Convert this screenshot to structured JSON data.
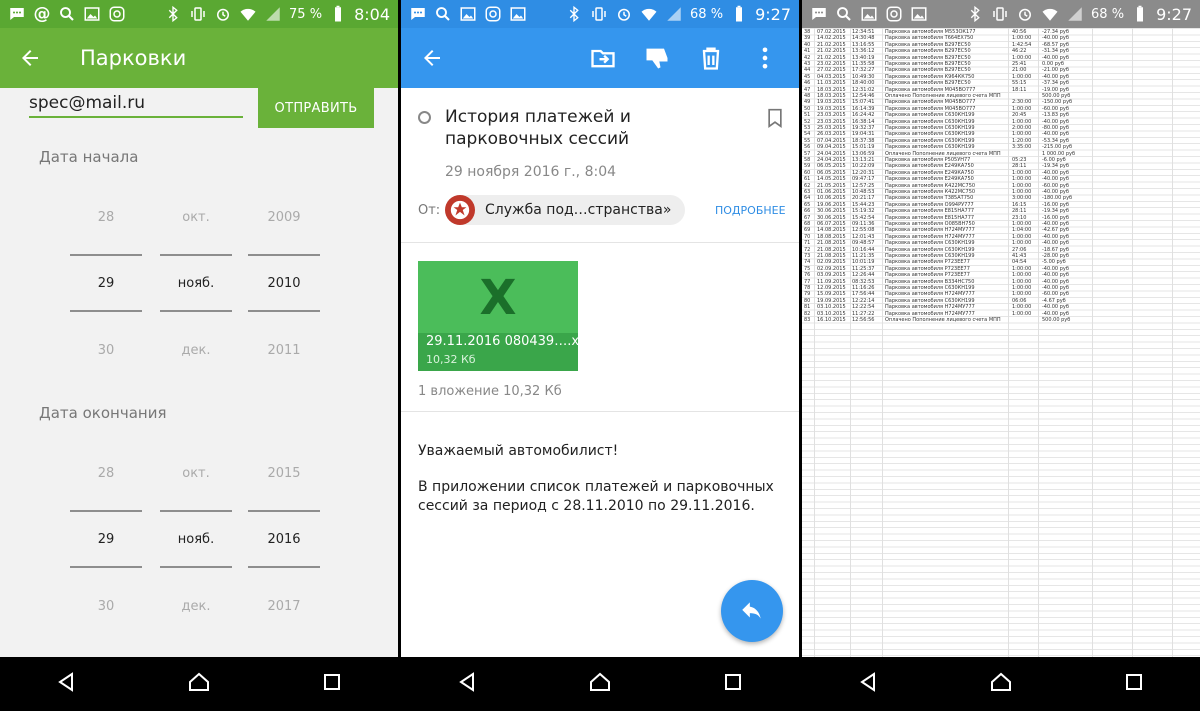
{
  "status_left": {
    "time": "8:04",
    "battery": "75 %"
  },
  "status_middle": {
    "time": "9:27",
    "battery": "68 %"
  },
  "status_right": {
    "time": "9:27",
    "battery": "68 %"
  },
  "colors": {
    "green": "#6ab23a",
    "blue": "#3596ee",
    "excel_green": "#4bbd5a"
  },
  "parking": {
    "title": "Парковки",
    "email_value": "spec@mail.ru",
    "send_label": "ОТПРАВИТЬ",
    "start_label": "Дата начала",
    "end_label": "Дата окончания",
    "start_picker": {
      "day": [
        "28",
        "29",
        "30"
      ],
      "month": [
        "окт.",
        "нояб.",
        "дек."
      ],
      "year": [
        "2009",
        "2010",
        "2011"
      ]
    },
    "end_picker": {
      "day": [
        "28",
        "29",
        "30"
      ],
      "month": [
        "окт.",
        "нояб.",
        "дек."
      ],
      "year": [
        "2015",
        "2016",
        "2017"
      ]
    }
  },
  "mail": {
    "subject": "История платежей и парковочных сессий",
    "date": "29 ноября 2016 г., 8:04",
    "from_label": "От:",
    "from_name": "Служба под…странства»",
    "more_label": "ПОДРОБНЕЕ",
    "attachment": {
      "icon_letter": "X",
      "file_name": "29.11.2016 080439….xlsx",
      "file_size": "10,32 Кб"
    },
    "attach_count": "1 вложение 10,32 Кб",
    "greeting": "Уважаемый автомобилист!",
    "body": "В приложении список платежей и парковочных сессий за период с 28.11.2010 по 29.11.2016."
  },
  "sheet": {
    "rows": [
      {
        "n": "38",
        "d": "07.02.2015",
        "t": "12:34:51",
        "desc": "Парковка автомобиля М553ОК177",
        "q": "40:56",
        "s": "-27.34 руб"
      },
      {
        "n": "39",
        "d": "14.02.2015",
        "t": "14:30:48",
        "desc": "Парковка автомобиля Т664ЕХ750",
        "q": "1:00:00",
        "s": "-40.00 руб"
      },
      {
        "n": "40",
        "d": "21.02.2015",
        "t": "13:16:55",
        "desc": "Парковка автомобиля В297ЕС50",
        "q": "1:42:54",
        "s": "-68.57 руб"
      },
      {
        "n": "41",
        "d": "21.02.2015",
        "t": "13:36:12",
        "desc": "Парковка автомобиля В297ЕС50",
        "q": "46:22",
        "s": "-31.34 руб"
      },
      {
        "n": "42",
        "d": "21.02.2015",
        "t": "13:40:19",
        "desc": "Парковка автомобиля В297ЕС50",
        "q": "1:00:00",
        "s": "-40.00 руб"
      },
      {
        "n": "43",
        "d": "23.02.2015",
        "t": "11:35:58",
        "desc": "Парковка автомобиля В297ЕС50",
        "q": "25:41",
        "s": "0.00 руб"
      },
      {
        "n": "44",
        "d": "27.02.2015",
        "t": "17:32:27",
        "desc": "Парковка автомобиля В297ЕС50",
        "q": "21:00",
        "s": "-21.00 руб"
      },
      {
        "n": "45",
        "d": "04.03.2015",
        "t": "10:49:30",
        "desc": "Парковка автомобиля К964КК750",
        "q": "1:00:00",
        "s": "-40.00 руб"
      },
      {
        "n": "46",
        "d": "11.03.2015",
        "t": "18:40:00",
        "desc": "Парковка автомобиля В297ЕС50",
        "q": "55:15",
        "s": "-37.34 руб"
      },
      {
        "n": "47",
        "d": "18.03.2015",
        "t": "12:31:02",
        "desc": "Парковка автомобиля М045ВО777",
        "q": "18:11",
        "s": "-19.00 руб"
      },
      {
        "n": "48",
        "d": "18.03.2015",
        "t": "12:54:46",
        "desc": "Оплачено Пополнение лицевого счета МПП",
        "q": "",
        "s": "500.00 руб"
      },
      {
        "n": "49",
        "d": "19.03.2015",
        "t": "15:07:41",
        "desc": "Парковка автомобиля М045ВО777",
        "q": "2:30:00",
        "s": "-150.00 руб"
      },
      {
        "n": "50",
        "d": "19.03.2015",
        "t": "16:14:39",
        "desc": "Парковка автомобиля М045ВО777",
        "q": "1:00:00",
        "s": "-60.00 руб"
      },
      {
        "n": "51",
        "d": "23.03.2015",
        "t": "16:24:42",
        "desc": "Парковка автомобиля С630КН199",
        "q": "20:45",
        "s": "-13.83 руб"
      },
      {
        "n": "52",
        "d": "23.03.2015",
        "t": "16:38:14",
        "desc": "Парковка автомобиля С630КН199",
        "q": "1:00:00",
        "s": "-40.00 руб"
      },
      {
        "n": "53",
        "d": "25.03.2015",
        "t": "19:32:37",
        "desc": "Парковка автомобиля С630КН199",
        "q": "2:00:00",
        "s": "-80.00 руб"
      },
      {
        "n": "54",
        "d": "26.03.2015",
        "t": "19:04:31",
        "desc": "Парковка автомобиля С630КН199",
        "q": "1:00:00",
        "s": "-40.00 руб"
      },
      {
        "n": "55",
        "d": "07.04.2015",
        "t": "18:37:38",
        "desc": "Парковка автомобиля С630КН199",
        "q": "1:20:00",
        "s": "-53.34 руб"
      },
      {
        "n": "56",
        "d": "09.04.2015",
        "t": "15:01:19",
        "desc": "Парковка автомобиля С630КН199",
        "q": "3:35:00",
        "s": "-215.00 руб"
      },
      {
        "n": "57",
        "d": "24.04.2015",
        "t": "13:06:59",
        "desc": "Оплачено Пополнение лицевого счета МПП",
        "q": "",
        "s": "1 000.00 руб"
      },
      {
        "n": "58",
        "d": "24.04.2015",
        "t": "13:13:21",
        "desc": "Парковка автомобиля Р505УН77",
        "q": "05:23",
        "s": "-6.00 руб"
      },
      {
        "n": "59",
        "d": "06.05.2015",
        "t": "10:22:09",
        "desc": "Парковка автомобиля Е249КА750",
        "q": "28:11",
        "s": "-19.34 руб"
      },
      {
        "n": "60",
        "d": "06.05.2015",
        "t": "12:20:31",
        "desc": "Парковка автомобиля Е249КА750",
        "q": "1:00:00",
        "s": "-40.00 руб"
      },
      {
        "n": "61",
        "d": "14.05.2015",
        "t": "09:47:17",
        "desc": "Парковка автомобиля Е249КА750",
        "q": "1:00:00",
        "s": "-40.00 руб"
      },
      {
        "n": "62",
        "d": "21.05.2015",
        "t": "12:57:25",
        "desc": "Парковка автомобиля К422МС750",
        "q": "1:00:00",
        "s": "-60.00 руб"
      },
      {
        "n": "63",
        "d": "01.06.2015",
        "t": "10:48:53",
        "desc": "Парковка автомобиля К422МС750",
        "q": "1:00:00",
        "s": "-40.00 руб"
      },
      {
        "n": "64",
        "d": "10.06.2015",
        "t": "20:21:17",
        "desc": "Парковка автомобиля Т385АТ750",
        "q": "3:00:00",
        "s": "-180.00 руб"
      },
      {
        "n": "65",
        "d": "19.06.2015",
        "t": "15:44:23",
        "desc": "Парковка автомобиля О994РУ777",
        "q": "16:15",
        "s": "-16.00 руб"
      },
      {
        "n": "66",
        "d": "30.06.2015",
        "t": "15:19:32",
        "desc": "Парковка автомобиля Е815НА777",
        "q": "28:11",
        "s": "-19.34 руб"
      },
      {
        "n": "67",
        "d": "30.06.2015",
        "t": "15:42:54",
        "desc": "Парковка автомобиля Е815НА777",
        "q": "23:10",
        "s": "-16.00 руб"
      },
      {
        "n": "68",
        "d": "06.07.2015",
        "t": "09:11:36",
        "desc": "Парковка автомобиля О085ВН750",
        "q": "1:00:00",
        "s": "-40.00 руб"
      },
      {
        "n": "69",
        "d": "14.08.2015",
        "t": "12:55:08",
        "desc": "Парковка автомобиля Н724МУ777",
        "q": "1:04:00",
        "s": "-42.67 руб"
      },
      {
        "n": "70",
        "d": "18.08.2015",
        "t": "12:01:43",
        "desc": "Парковка автомобиля Н724МУ777",
        "q": "1:00:00",
        "s": "-40.00 руб"
      },
      {
        "n": "71",
        "d": "21.08.2015",
        "t": "09:48:57",
        "desc": "Парковка автомобиля С630КН199",
        "q": "1:00:00",
        "s": "-40.00 руб"
      },
      {
        "n": "72",
        "d": "21.08.2015",
        "t": "10:16:44",
        "desc": "Парковка автомобиля С630КН199",
        "q": "27:06",
        "s": "-18.67 руб"
      },
      {
        "n": "73",
        "d": "21.08.2015",
        "t": "11:21:35",
        "desc": "Парковка автомобиля С630КН199",
        "q": "41:43",
        "s": "-28.00 руб"
      },
      {
        "n": "74",
        "d": "02.09.2015",
        "t": "10:01:19",
        "desc": "Парковка автомобиля Р723ЕЕ77",
        "q": "04:54",
        "s": "-5.00 руб"
      },
      {
        "n": "75",
        "d": "02.09.2015",
        "t": "11:25:37",
        "desc": "Парковка автомобиля Р723ЕЕ77",
        "q": "1:00:00",
        "s": "-40.00 руб"
      },
      {
        "n": "76",
        "d": "03.09.2015",
        "t": "12:26:44",
        "desc": "Парковка автомобиля Р723ЕЕ77",
        "q": "1:00:00",
        "s": "-40.00 руб"
      },
      {
        "n": "77",
        "d": "11.09.2015",
        "t": "08:32:53",
        "desc": "Парковка автомобиля В334НС750",
        "q": "1:00:00",
        "s": "-40.00 руб"
      },
      {
        "n": "78",
        "d": "12.09.2015",
        "t": "11:16:26",
        "desc": "Парковка автомобиля С630КН199",
        "q": "1:00:00",
        "s": "-40.00 руб"
      },
      {
        "n": "79",
        "d": "15.09.2015",
        "t": "17:56:44",
        "desc": "Парковка автомобиля Н724МУ777",
        "q": "1:00:00",
        "s": "-60.00 руб"
      },
      {
        "n": "80",
        "d": "19.09.2015",
        "t": "12:22:14",
        "desc": "Парковка автомобиля С630КН199",
        "q": "06:06",
        "s": "-4.67 руб"
      },
      {
        "n": "81",
        "d": "03.10.2015",
        "t": "12:22:54",
        "desc": "Парковка автомобиля Н724МУ777",
        "q": "1:00:00",
        "s": "-40.00 руб"
      },
      {
        "n": "82",
        "d": "03.10.2015",
        "t": "11:27:22",
        "desc": "Парковка автомобиля Н724МУ777",
        "q": "1:00:00",
        "s": "-40.00 руб"
      },
      {
        "n": "83",
        "d": "16.10.2015",
        "t": "12:56:56",
        "desc": "Оплачено Пополнение лицевого счета МПП",
        "q": "",
        "s": "500.00 руб"
      }
    ]
  }
}
